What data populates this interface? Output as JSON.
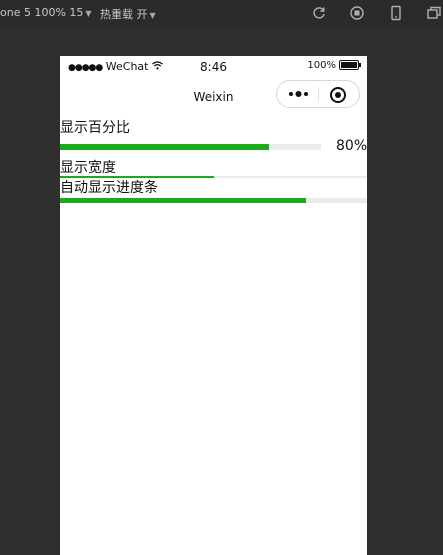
{
  "toolbar": {
    "device_label": "one 5 100% 15",
    "hotreload_label": "热重载 开"
  },
  "status_bar": {
    "carrier": "WeChat",
    "time": "8:46",
    "battery": "100%"
  },
  "nav": {
    "title": "Weixin"
  },
  "progress": [
    {
      "label": "显示百分比",
      "percent": 80,
      "percent_text": "80%"
    },
    {
      "label": "显示宽度",
      "percent": 50
    },
    {
      "label": "自动显示进度条",
      "percent": 80
    }
  ],
  "colors": {
    "active": "#1aad19",
    "track": "#ebebeb"
  }
}
